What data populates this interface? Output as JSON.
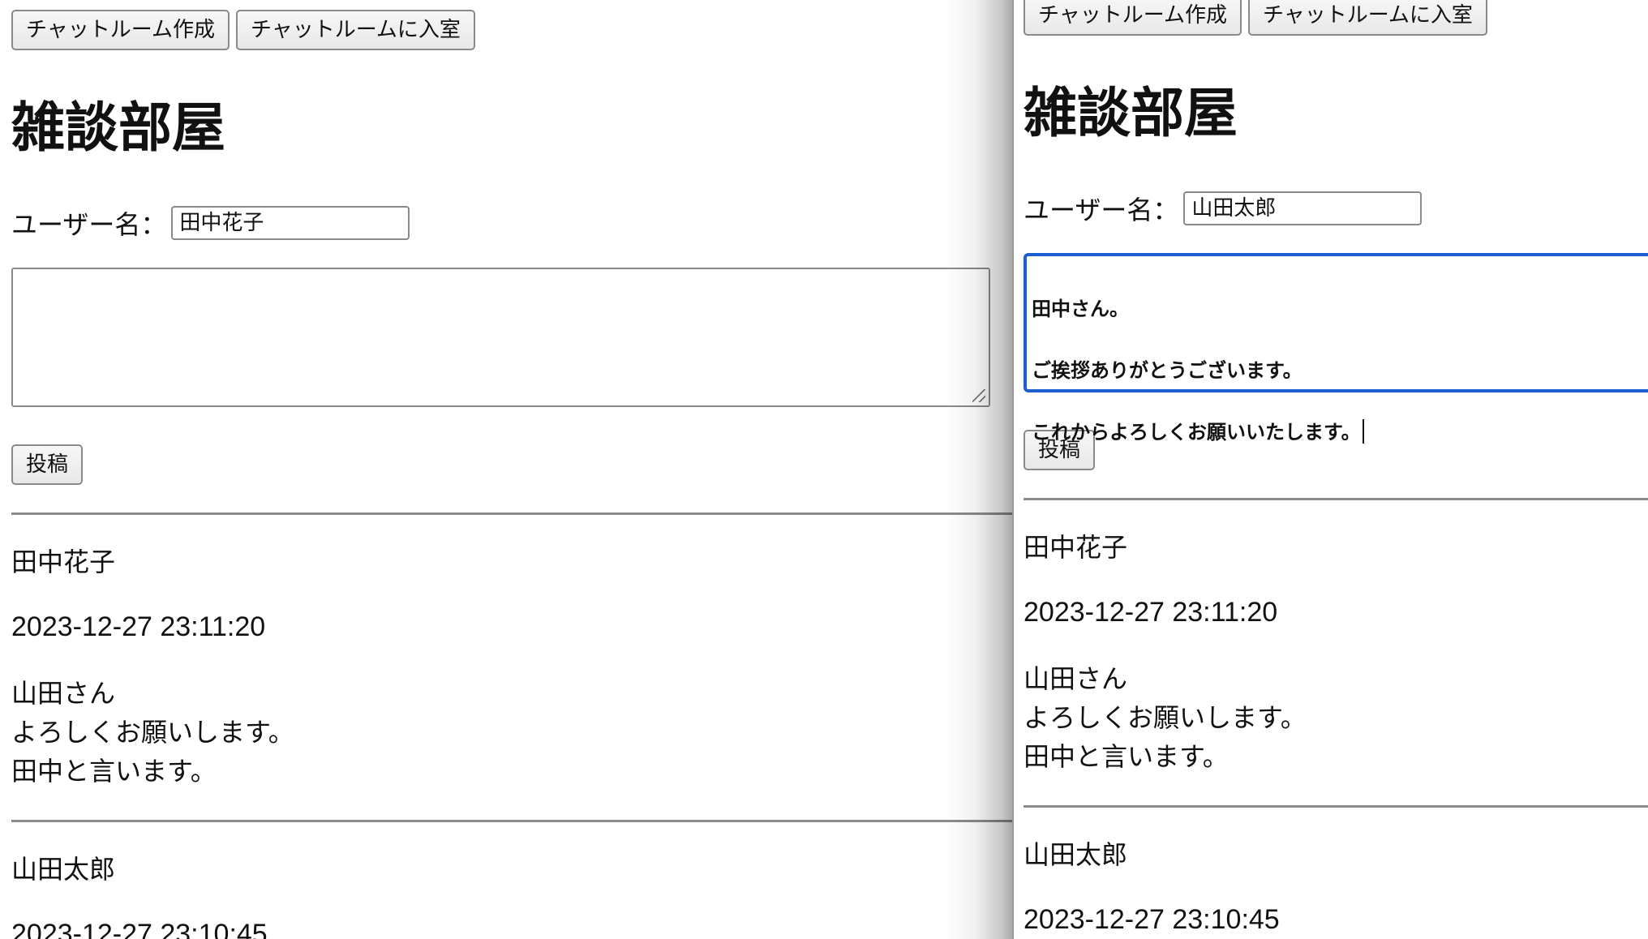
{
  "left_window": {
    "toolbar": {
      "create_room_label": "チャットルーム作成",
      "enter_room_label": "チャットルームに入室"
    },
    "room_title": "雑談部屋",
    "username": {
      "label": "ユーザー名：",
      "value": "田中花子"
    },
    "message_input": {
      "value": ""
    },
    "post_button_label": "投稿",
    "messages": [
      {
        "user": "田中花子",
        "timestamp": "2023-12-27 23:11:20",
        "lines": [
          "山田さん",
          "よろしくお願いします。",
          "田中と言います。"
        ]
      },
      {
        "user": "山田太郎",
        "timestamp": "2023-12-27 23:10:45"
      }
    ]
  },
  "right_window": {
    "toolbar": {
      "create_room_label": "チャットルーム作成",
      "enter_room_label": "チャットルームに入室"
    },
    "room_title": "雑談部屋",
    "username": {
      "label": "ユーザー名：",
      "value": "山田太郎"
    },
    "message_input": {
      "lines": [
        "田中さん。",
        "ご挨拶ありがとうございます。",
        "これからよろしくお願いいたします。"
      ]
    },
    "post_button_label": "投稿",
    "messages": [
      {
        "user": "田中花子",
        "timestamp": "2023-12-27 23:11:20",
        "lines": [
          "山田さん",
          "よろしくお願いします。",
          "田中と言います。"
        ]
      },
      {
        "user": "山田太郎",
        "timestamp": "2023-12-27 23:10:45"
      }
    ]
  },
  "colors": {
    "focus_ring": "#1b5fd0",
    "separator": "#8c8c8c",
    "text": "#111111"
  }
}
